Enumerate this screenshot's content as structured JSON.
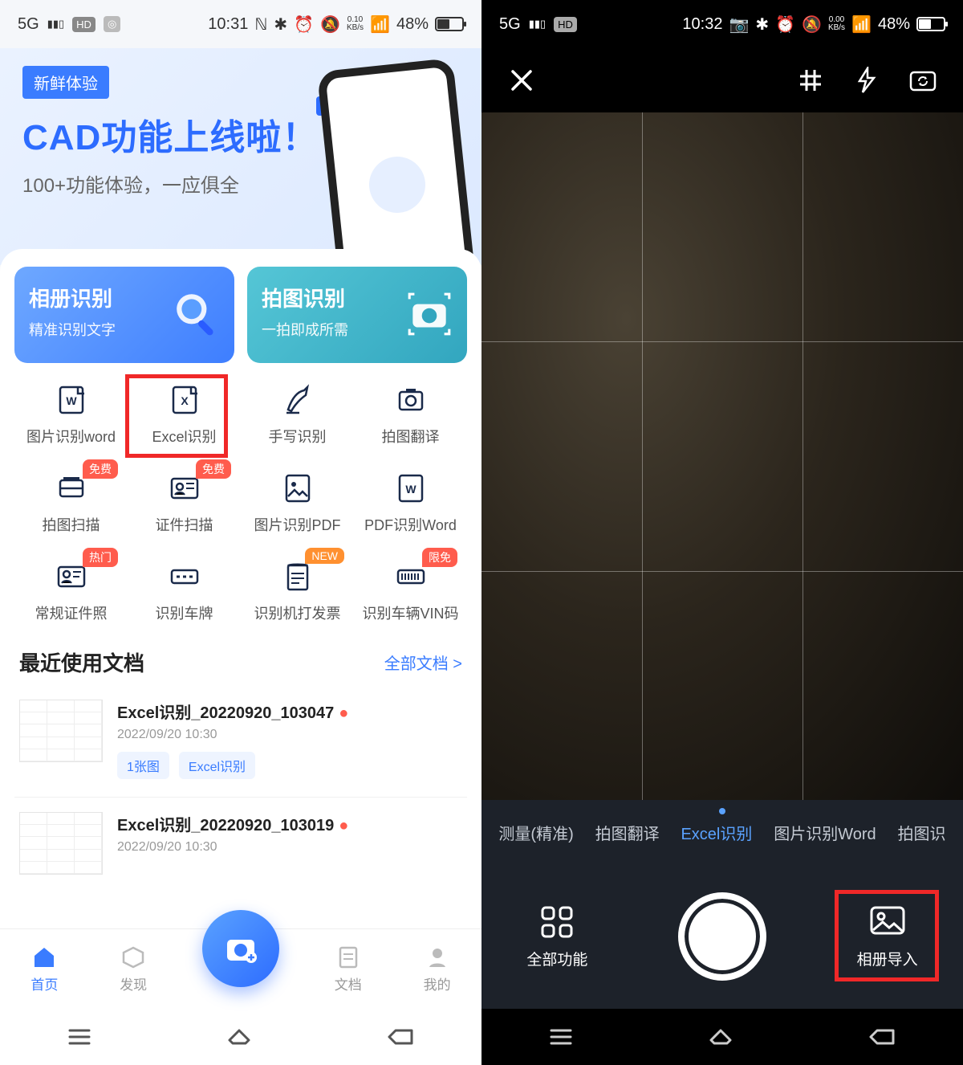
{
  "left": {
    "status": {
      "time": "10:31",
      "battery": "48%",
      "data": "0.10",
      "unit": "KB/s",
      "net": "5G",
      "hd": "HD"
    },
    "hero": {
      "badge": "新鲜体验",
      "title": "CAD功能上线啦！",
      "subtitle": "100+功能体验，一应俱全",
      "cad": "CAD"
    },
    "cards": {
      "album": {
        "title": "相册识别",
        "subtitle": "精准识别文字"
      },
      "camera": {
        "title": "拍图识别",
        "subtitle": "一拍即成所需"
      }
    },
    "features": [
      {
        "label": "图片识别word"
      },
      {
        "label": "Excel识别",
        "highlight": true
      },
      {
        "label": "手写识别"
      },
      {
        "label": "拍图翻译"
      },
      {
        "label": "拍图扫描",
        "tag": "免费",
        "tagc": "free"
      },
      {
        "label": "证件扫描",
        "tag": "免费",
        "tagc": "free"
      },
      {
        "label": "图片识别PDF"
      },
      {
        "label": "PDF识别Word"
      },
      {
        "label": "常规证件照",
        "tag": "热门",
        "tagc": "hot"
      },
      {
        "label": "识别车牌"
      },
      {
        "label": "识别机打发票",
        "tag": "NEW",
        "tagc": "new"
      },
      {
        "label": "识别车辆VIN码",
        "tag": "限免",
        "tagc": "lim"
      }
    ],
    "recent": {
      "title": "最近使用文档",
      "all": "全部文档 >",
      "docs": [
        {
          "name": "Excel识别_20220920_103047",
          "time": "2022/09/20 10:30",
          "chip1": "1张图",
          "chip2": "Excel识别"
        },
        {
          "name": "Excel识别_20220920_103019",
          "time": "2022/09/20 10:30"
        }
      ]
    },
    "nav": {
      "home": "首页",
      "discover": "发现",
      "docs": "文档",
      "me": "我的"
    }
  },
  "right": {
    "status": {
      "time": "10:32",
      "battery": "48%",
      "data": "0.00",
      "unit": "KB/s",
      "net": "5G",
      "hd": "HD"
    },
    "modes": [
      {
        "label": "测量(精准)"
      },
      {
        "label": "拍图翻译"
      },
      {
        "label": "Excel识别",
        "active": true
      },
      {
        "label": "图片识别Word"
      },
      {
        "label": "拍图识"
      }
    ],
    "capbar": {
      "all": "全部功能",
      "import": "相册导入"
    }
  }
}
